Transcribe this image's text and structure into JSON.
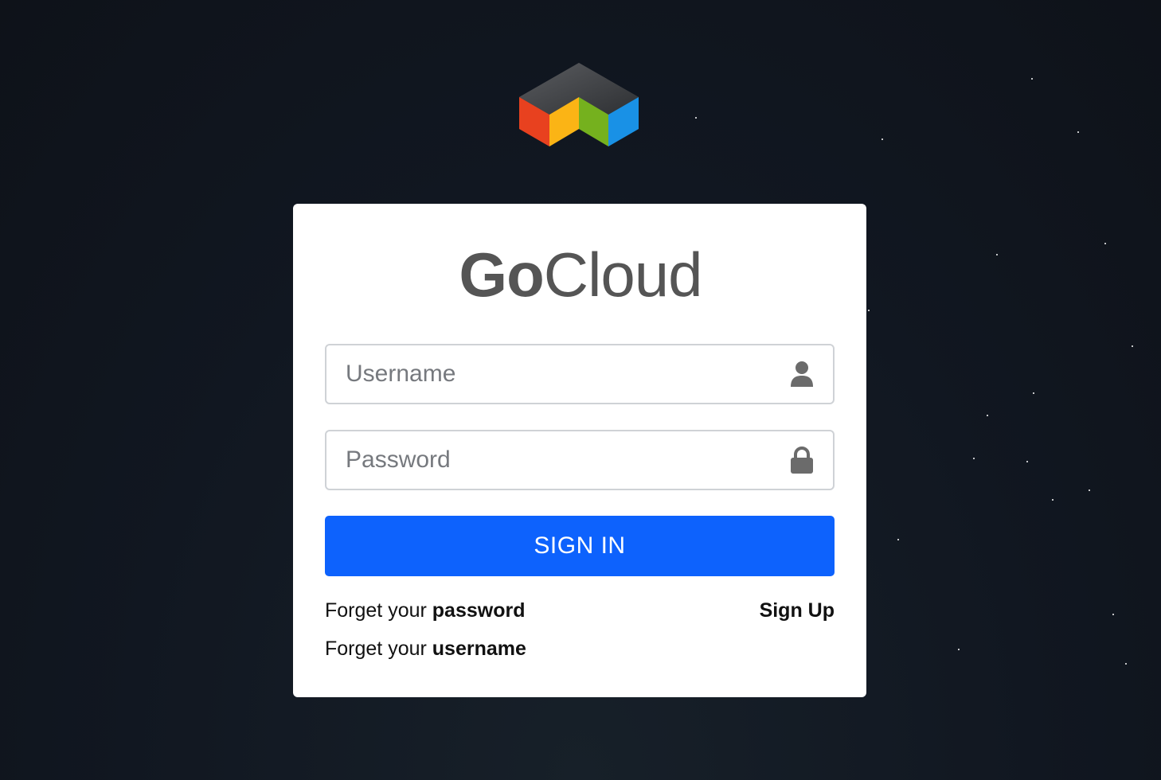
{
  "colors": {
    "background": "#111721",
    "card": "#ffffff",
    "primary": "#0d62fd",
    "brand_text": "#555555",
    "logo_red": "#e8411f",
    "logo_yellow": "#fbb415",
    "logo_green": "#75b11e",
    "logo_blue": "#1991e6",
    "logo_top": "#4a4c50"
  },
  "logo": {
    "icon": "cube-logo-icon"
  },
  "brand": {
    "bold": "Go",
    "light": "Cloud"
  },
  "form": {
    "username": {
      "placeholder": "Username",
      "value": "",
      "icon": "user-icon"
    },
    "password": {
      "placeholder": "Password",
      "value": "",
      "icon": "lock-icon"
    },
    "sign_in_label": "SIGN IN"
  },
  "links": {
    "forgot_password_prefix": "Forget your ",
    "forgot_password_bold": "password",
    "forgot_username_prefix": "Forget your ",
    "forgot_username_bold": "username",
    "sign_up": "Sign Up"
  }
}
